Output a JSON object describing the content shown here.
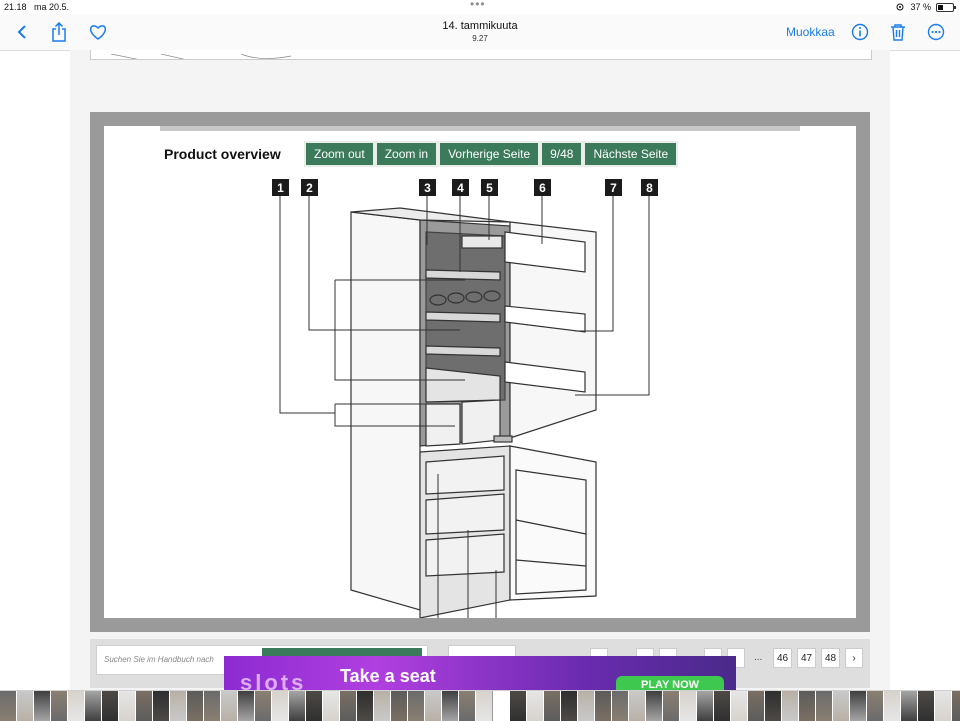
{
  "status_bar": {
    "time": "21.18",
    "date": "ma 20.5.",
    "battery": "37 %"
  },
  "nav": {
    "title": "14. tammikuuta",
    "subtitle": "9.27",
    "edit_label": "Muokkaa",
    "icons": [
      "back-icon",
      "share-icon",
      "heart-icon",
      "info-icon",
      "trash-icon",
      "more-icon"
    ]
  },
  "viewer": {
    "section_title": "Product overview",
    "buttons": [
      "Zoom out",
      "Zoom in",
      "Vorherige Seite",
      "9/48",
      "Nächste Seite"
    ],
    "callouts": [
      "1",
      "2",
      "3",
      "4",
      "5",
      "6",
      "7",
      "8"
    ]
  },
  "bottom": {
    "search_placeholder": "Suchen Sie im Handbuch nach",
    "pages": [
      "46",
      "47",
      "48"
    ],
    "ellipsis": "...",
    "next_icon": "›"
  },
  "ad": {
    "logo": "slots",
    "text": "Take a seat",
    "button": "PLAY NOW"
  },
  "colors": {
    "accent": "#1a7cf0",
    "viewer_button": "#3b7a5a",
    "viewer_frame": "#9a9a9a"
  }
}
